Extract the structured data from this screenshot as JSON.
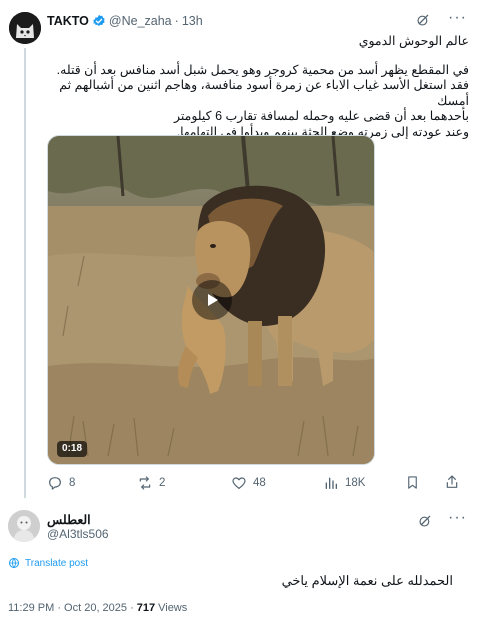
{
  "post": {
    "author_name": "TAKTO",
    "author_handle": "@Ne_zaha",
    "separator": "·",
    "time_ago": "13h",
    "title_line": "عالم الوحوش الدموي",
    "body_lines": [
      "في المقطع يظهر أسد من محمية كروجر وهو يحمل شبل أسد منافس بعد أن قتله.",
      "فقد استغل الأسد غياب الاباء عن زمرة أسود منافسة، وهاجم اثنين من أشبالهم ثم أمسك",
      "بأحدهما بعد أن قضى عليه وحمله لمسافة تقارب 6 كيلومتر",
      "وعند عودته إلى زمرته وضع الجثة بينهم وبدأوا في التهامها."
    ],
    "video_duration": "0:18",
    "stats": {
      "replies": "8",
      "reposts": "2",
      "likes": "48",
      "views": "18K"
    }
  },
  "reply": {
    "author_name": "العطلس",
    "author_handle": "@Al3tls506",
    "translate_label": "Translate post",
    "text": "الحمدلله على نعمة الإسلام ياخي",
    "timestamp": "11:29 PM · Oct 20, 2025 ·",
    "views_count": "717",
    "views_label": "Views"
  },
  "colors": {
    "text_primary": "#0f1419",
    "text_secondary": "#536471",
    "accent": "#1d9bf0",
    "divider": "#cfd9de"
  },
  "icons": [
    "cat-avatar-icon",
    "verified-badge-icon",
    "grok-icon",
    "more-icon",
    "play-icon",
    "reply-icon",
    "repost-icon",
    "like-icon",
    "views-icon",
    "bookmark-icon",
    "share-icon",
    "translate-icon"
  ]
}
